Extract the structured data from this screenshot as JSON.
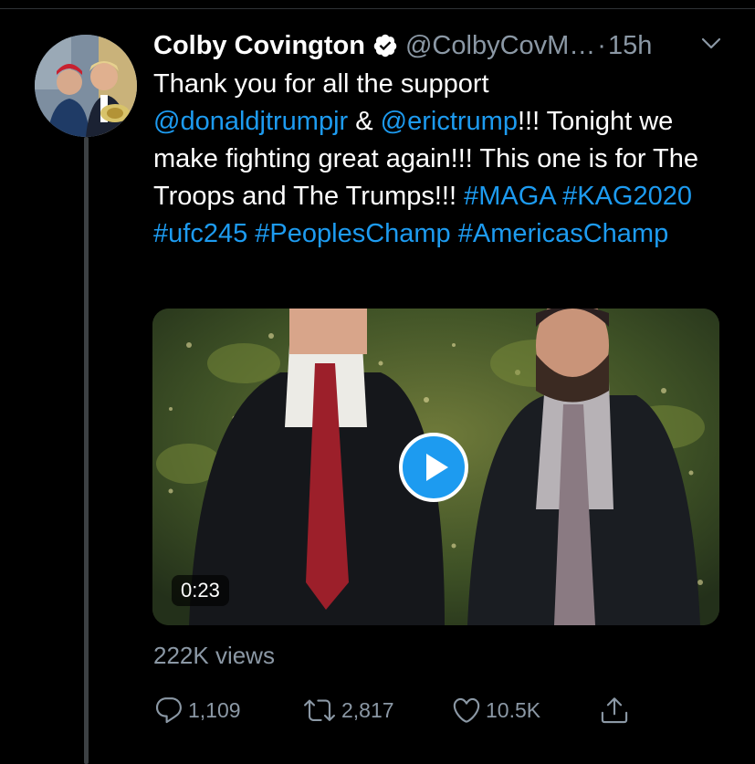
{
  "tweet": {
    "author_name": "Colby Covington",
    "handle": "@ColbyCovM…",
    "separator": "·",
    "time": "15h",
    "text": {
      "line1": "Thank you for all the support",
      "mention1": "@donaldjtrumpjr",
      "amp": " & ",
      "mention2": "@erictrump",
      "after_mention": "!!! Tonight we make fighting great again!!! This one is for The Troops and The Trumps!!! ",
      "hashtag1": "#MAGA",
      "hashtag2": "#KAG2020",
      "hashtag3": "#ufc245",
      "hashtag4": "#PeoplesChamp",
      "hashtag5": "#AmericasChamp"
    },
    "video": {
      "duration": "0:23"
    },
    "views": "222K views",
    "actions": {
      "replies": "1,109",
      "retweets": "2,817",
      "likes": "10.5K"
    }
  },
  "colors": {
    "background": "#000000",
    "link": "#1d9bf0",
    "secondary_text": "#8b98a5",
    "verified_badge": "#ffffff"
  },
  "icons": [
    "verified-badge-icon",
    "chevron-down-icon",
    "play-icon",
    "reply-icon",
    "retweet-icon",
    "like-icon",
    "share-icon"
  ]
}
